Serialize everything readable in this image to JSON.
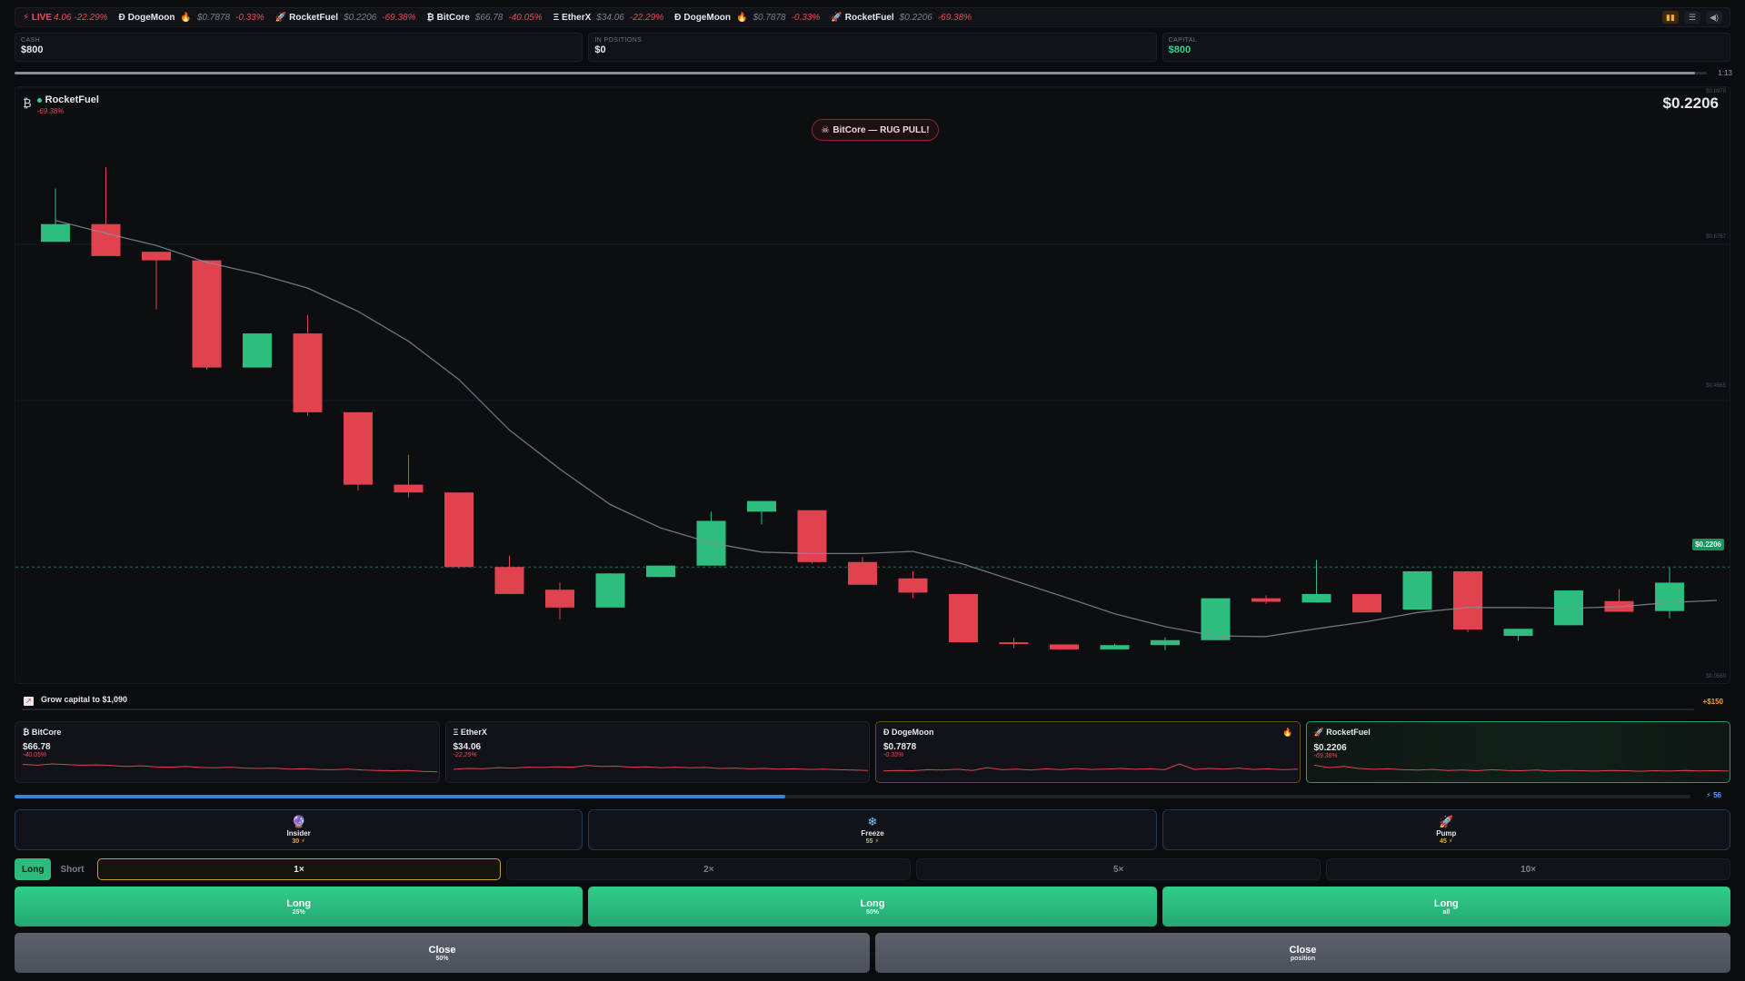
{
  "ticker": {
    "live_label": "⚡ LIVE",
    "lead_fragment": "4.06 -22.29%",
    "items": [
      {
        "icon": "Ð",
        "name": "DogeMoon",
        "hot": true,
        "price": "$0.7878",
        "change": "-0.33%"
      },
      {
        "icon": "🚀",
        "name": "RocketFuel",
        "hot": false,
        "price": "$0.2206",
        "change": "-69.38%"
      },
      {
        "icon": "₿",
        "name": "BitCore",
        "hot": false,
        "price": "$66.78",
        "change": "-40.05%"
      },
      {
        "icon": "Ξ",
        "name": "EtherX",
        "hot": false,
        "price": "$34.06",
        "change": "-22.29%"
      },
      {
        "icon": "Ð",
        "name": "DogeMoon",
        "hot": true,
        "price": "$0.7878",
        "change": "-0.33%"
      },
      {
        "icon": "🚀",
        "name": "RocketFuel",
        "hot": false,
        "price": "$0.2206",
        "change": "-69.38%"
      }
    ],
    "icons": [
      "pause-icon",
      "menu-icon",
      "volume-icon"
    ]
  },
  "stats": {
    "cash_label": "CASH",
    "cash_value": "$800",
    "positions_label": "IN POSITIONS",
    "positions_value": "$0",
    "capital_label": "CAPITAL",
    "capital_value": "$800"
  },
  "timer": {
    "label": "1:13",
    "fraction": 0.993
  },
  "chart": {
    "asset_icon": "₿",
    "asset_name": "RocketFuel",
    "asset_change": "-69.38%",
    "price": "$0.2206",
    "event_label": "BitCore — RUG PULL!",
    "event_icon": "skull-icon",
    "y_labels": [
      "$0.8978",
      "$0.6767",
      "$0.4565",
      "$0.2206",
      "$0.0560"
    ],
    "last_price_tag": "$0.2206"
  },
  "chart_data": {
    "type": "candlestick",
    "ylim": [
      0.056,
      0.8978
    ],
    "candles": [
      {
        "o": 0.68,
        "h": 0.755,
        "l": 0.68,
        "c": 0.705
      },
      {
        "o": 0.705,
        "h": 0.785,
        "l": 0.66,
        "c": 0.66
      },
      {
        "o": 0.666,
        "h": 0.666,
        "l": 0.585,
        "c": 0.654
      },
      {
        "o": 0.654,
        "h": 0.654,
        "l": 0.5,
        "c": 0.503
      },
      {
        "o": 0.503,
        "h": 0.551,
        "l": 0.503,
        "c": 0.551
      },
      {
        "o": 0.551,
        "h": 0.577,
        "l": 0.435,
        "c": 0.44
      },
      {
        "o": 0.44,
        "h": 0.44,
        "l": 0.33,
        "c": 0.338
      },
      {
        "o": 0.338,
        "h": 0.38,
        "l": 0.32,
        "c": 0.327
      },
      {
        "o": 0.327,
        "h": 0.327,
        "l": 0.22,
        "c": 0.222
      },
      {
        "o": 0.222,
        "h": 0.238,
        "l": 0.184,
        "c": 0.184
      },
      {
        "o": 0.19,
        "h": 0.2,
        "l": 0.148,
        "c": 0.165
      },
      {
        "o": 0.165,
        "h": 0.213,
        "l": 0.165,
        "c": 0.213
      },
      {
        "o": 0.208,
        "h": 0.224,
        "l": 0.208,
        "c": 0.224
      },
      {
        "o": 0.224,
        "h": 0.3,
        "l": 0.224,
        "c": 0.287
      },
      {
        "o": 0.3,
        "h": 0.315,
        "l": 0.282,
        "c": 0.315
      },
      {
        "o": 0.302,
        "h": 0.302,
        "l": 0.227,
        "c": 0.229
      },
      {
        "o": 0.229,
        "h": 0.236,
        "l": 0.197,
        "c": 0.197
      },
      {
        "o": 0.206,
        "h": 0.216,
        "l": 0.178,
        "c": 0.186
      },
      {
        "o": 0.184,
        "h": 0.184,
        "l": 0.116,
        "c": 0.116
      },
      {
        "o": 0.116,
        "h": 0.122,
        "l": 0.108,
        "c": 0.114
      },
      {
        "o": 0.113,
        "h": 0.113,
        "l": 0.106,
        "c": 0.106
      },
      {
        "o": 0.106,
        "h": 0.114,
        "l": 0.106,
        "c": 0.112
      },
      {
        "o": 0.112,
        "h": 0.123,
        "l": 0.105,
        "c": 0.119
      },
      {
        "o": 0.119,
        "h": 0.178,
        "l": 0.119,
        "c": 0.178
      },
      {
        "o": 0.178,
        "h": 0.182,
        "l": 0.17,
        "c": 0.173
      },
      {
        "o": 0.172,
        "h": 0.232,
        "l": 0.172,
        "c": 0.184
      },
      {
        "o": 0.184,
        "h": 0.184,
        "l": 0.158,
        "c": 0.158
      },
      {
        "o": 0.162,
        "h": 0.216,
        "l": 0.162,
        "c": 0.216
      },
      {
        "o": 0.216,
        "h": 0.216,
        "l": 0.13,
        "c": 0.134
      },
      {
        "o": 0.125,
        "h": 0.135,
        "l": 0.118,
        "c": 0.135
      },
      {
        "o": 0.14,
        "h": 0.189,
        "l": 0.14,
        "c": 0.189
      },
      {
        "o": 0.174,
        "h": 0.191,
        "l": 0.159,
        "c": 0.159
      },
      {
        "o": 0.16,
        "h": 0.221,
        "l": 0.15,
        "c": 0.2
      }
    ],
    "ma": [
      0.71,
      0.692,
      0.675,
      0.651,
      0.635,
      0.615,
      0.582,
      0.54,
      0.486,
      0.415,
      0.36,
      0.31,
      0.277,
      0.256,
      0.243,
      0.241,
      0.241,
      0.244,
      0.226,
      0.203,
      0.18,
      0.156,
      0.138,
      0.125,
      0.124,
      0.135,
      0.145,
      0.158,
      0.165,
      0.165,
      0.164,
      0.166,
      0.172
    ]
  },
  "goal": {
    "label": "Grow capital to $1,090",
    "amount": "+$150",
    "icon": "chart-icon"
  },
  "asset_cards": [
    {
      "icon": "₿",
      "name": "BitCore",
      "price": "$66.78",
      "change": "-40.05%",
      "hot": false,
      "active": false,
      "spark": [
        0.75,
        0.7,
        0.78,
        0.74,
        0.7,
        0.72,
        0.68,
        0.62,
        0.66,
        0.6,
        0.58,
        0.62,
        0.56,
        0.54,
        0.58,
        0.52,
        0.5,
        0.52,
        0.46,
        0.48,
        0.44,
        0.42,
        0.46,
        0.4,
        0.38,
        0.36,
        0.38,
        0.32,
        0.3
      ]
    },
    {
      "icon": "Ξ",
      "name": "EtherX",
      "price": "$34.06",
      "change": "-22.29%",
      "hot": false,
      "active": false,
      "spark": [
        0.45,
        0.5,
        0.48,
        0.55,
        0.52,
        0.58,
        0.56,
        0.6,
        0.58,
        0.68,
        0.62,
        0.64,
        0.58,
        0.6,
        0.55,
        0.58,
        0.54,
        0.56,
        0.5,
        0.52,
        0.48,
        0.5,
        0.46,
        0.48,
        0.44,
        0.46,
        0.42,
        0.4,
        0.38
      ]
    },
    {
      "icon": "Ð",
      "name": "DogeMoon",
      "price": "$0.7878",
      "change": "-0.33%",
      "hot": true,
      "active": false,
      "spark": [
        0.35,
        0.38,
        0.36,
        0.42,
        0.4,
        0.45,
        0.38,
        0.55,
        0.42,
        0.46,
        0.4,
        0.48,
        0.42,
        0.5,
        0.44,
        0.46,
        0.5,
        0.45,
        0.48,
        0.42,
        0.78,
        0.44,
        0.5,
        0.46,
        0.52,
        0.44,
        0.48,
        0.42,
        0.46
      ]
    },
    {
      "icon": "🚀",
      "name": "RocketFuel",
      "price": "$0.2206",
      "change": "-69.38%",
      "hot": false,
      "active": true,
      "spark": [
        0.7,
        0.55,
        0.62,
        0.5,
        0.45,
        0.48,
        0.42,
        0.4,
        0.44,
        0.38,
        0.4,
        0.36,
        0.42,
        0.38,
        0.36,
        0.4,
        0.34,
        0.38,
        0.36,
        0.34,
        0.38,
        0.36,
        0.33,
        0.36,
        0.34,
        0.38,
        0.35,
        0.36,
        0.34
      ]
    }
  ],
  "energy": {
    "label": "⚡ 56",
    "fraction": 0.46
  },
  "powers": [
    {
      "icon": "🔮",
      "name": "Insider",
      "cost": "30 ⚡"
    },
    {
      "icon": "❄",
      "name": "Freeze",
      "cost": "55 ⚡"
    },
    {
      "icon": "🚀",
      "name": "Pump",
      "cost": "45 ⚡"
    }
  ],
  "direction": {
    "long": "Long",
    "short": "Short"
  },
  "leverage": [
    "1×",
    "2×",
    "5×",
    "10×"
  ],
  "buy_buttons": [
    {
      "title": "Long",
      "sub": "25%"
    },
    {
      "title": "Long",
      "sub": "50%"
    },
    {
      "title": "Long",
      "sub": "all"
    }
  ],
  "close_buttons": [
    {
      "title": "Close",
      "sub": "50%"
    },
    {
      "title": "Close",
      "sub": "position"
    }
  ],
  "colors": {
    "up": "#2dbd7e",
    "down": "#e0434f",
    "accent": "#35d28e",
    "energy": "#3b82d6",
    "warn": "#f2a83b"
  }
}
